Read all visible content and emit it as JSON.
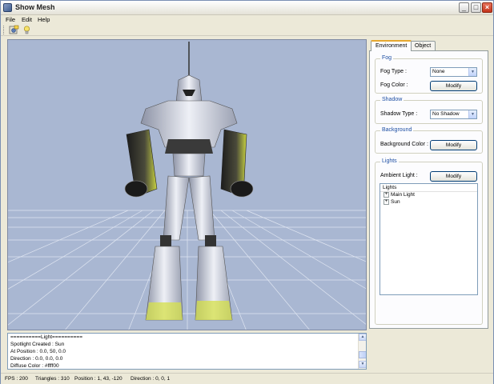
{
  "window": {
    "title": "Show Mesh",
    "controls": {
      "minimize": "_",
      "maximize": "□",
      "close": "×"
    }
  },
  "menu": {
    "items": [
      {
        "label": "File"
      },
      {
        "label": "Edit"
      },
      {
        "label": "Help"
      }
    ]
  },
  "toolbar": {
    "buttons": [
      {
        "icon": "open-mesh-icon"
      },
      {
        "icon": "light-bulb-icon"
      }
    ]
  },
  "panel": {
    "tabs": [
      {
        "label": "Environment",
        "active": true
      },
      {
        "label": "Object",
        "active": false
      }
    ],
    "fog": {
      "title": "Fog",
      "type_label": "Fog Type :",
      "type_value": "None",
      "color_label": "Fog Color :",
      "modify_label": "Modify"
    },
    "shadow": {
      "title": "Shadow",
      "type_label": "Shadow Type :",
      "type_value": "No Shadow"
    },
    "background": {
      "title": "Background",
      "color_label": "Background Color :",
      "modify_label": "Modify"
    },
    "lights": {
      "title": "Lights",
      "ambient_label": "Ambient Light :",
      "modify_label": "Modify",
      "list_header": "Lights",
      "items": [
        {
          "expander": "+",
          "label": "Main Light"
        },
        {
          "expander": "+",
          "label": "Sun"
        }
      ]
    }
  },
  "log": {
    "lines": [
      "==========Light==========",
      "Spotlight Created : Sun",
      "At Position : 0.0, 50, 0.0",
      "Direction : 0.0, 0.0, 0.0",
      "Diffuse Color : #ffff00"
    ]
  },
  "status": {
    "fps": "FPS : 200",
    "triangles": "Triangles : 310",
    "position": "Position : 1, 43, -120",
    "direction": "Direction : 0, 0, 1"
  },
  "colors": {
    "viewport_bg": "#a9b7d2",
    "grid_line": "#ffffff",
    "group_title": "#1e4fa3",
    "robot_body": "#dfe3ee",
    "robot_accent": "#d6e04a"
  }
}
